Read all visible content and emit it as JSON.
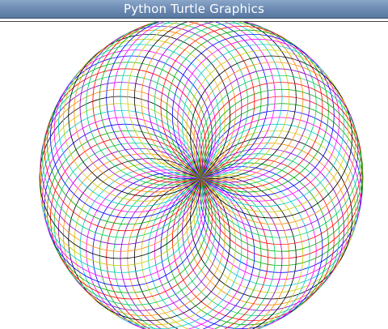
{
  "window": {
    "title": "Python Turtle Graphics"
  },
  "drawing": {
    "description_kind": "spirograph",
    "circle_count": 72,
    "colors": [
      "#ff0000",
      "#00aa00",
      "#0000ff",
      "#ff00ff",
      "#00cccc",
      "#cccc00",
      "#000000",
      "#ff8800",
      "#8800cc",
      "#00cc66"
    ],
    "background": "#ffffff"
  }
}
